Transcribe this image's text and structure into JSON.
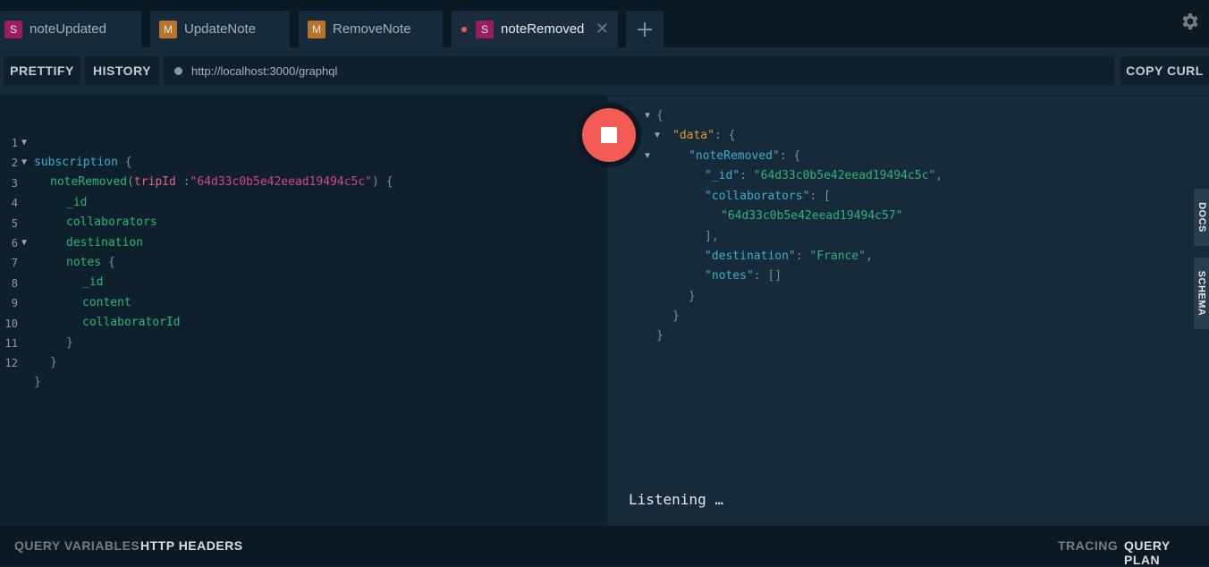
{
  "tabs": [
    {
      "badge": "S",
      "label": "noteUpdated",
      "type": "subscription"
    },
    {
      "badge": "M",
      "label": "UpdateNote",
      "type": "mutation"
    },
    {
      "badge": "M",
      "label": "RemoveNote",
      "type": "mutation"
    },
    {
      "badge": "S",
      "label": "noteRemoved",
      "type": "subscription",
      "active": true
    }
  ],
  "toolbar": {
    "prettify": "PRETTIFY",
    "history": "HISTORY",
    "endpoint": "http://localhost:3000/graphql",
    "copy_curl": "COPY CURL"
  },
  "editor": {
    "line_numbers": [
      "1",
      "2",
      "3",
      "4",
      "5",
      "6",
      "7",
      "8",
      "9",
      "10",
      "11",
      "12"
    ],
    "query": {
      "keyword": "subscription",
      "operation": "noteRemoved",
      "arg_name": "tripId",
      "arg_sep": " :",
      "arg_value": "\"64d33c0b5e42eead19494c5c\"",
      "fields": [
        "_id",
        "collaborators",
        "destination",
        "notes"
      ],
      "sub_fields": [
        "_id",
        "content",
        "collaboratorId"
      ]
    }
  },
  "result": {
    "data_key": "\"data\"",
    "noteRemoved_key": "\"noteRemoved\"",
    "id_key": "\"_id\"",
    "id_value": "\"64d33c0b5e42eead19494c5c\"",
    "collaborators_key": "\"collaborators\"",
    "collaborator_value": "\"64d33c0b5e42eead19494c57\"",
    "destination_key": "\"destination\"",
    "destination_value": "\"France\"",
    "notes_key": "\"notes\"",
    "notes_value": "[]",
    "status": "Listening …"
  },
  "side_tabs": {
    "docs": "DOCS",
    "schema": "SCHEMA"
  },
  "footer": {
    "query_variables": "QUERY VARIABLES",
    "http_headers": "HTTP HEADERS",
    "tracing": "TRACING",
    "query_plan": "QUERY PLAN"
  },
  "colors": {
    "stop_button": "#f25c54",
    "subscription_badge": "#9a1c63",
    "mutation_badge": "#b9732a"
  },
  "icons": {
    "settings": "gear-icon",
    "stop": "stop-icon",
    "add_tab": "plus-icon",
    "close_tab": "close-icon"
  }
}
